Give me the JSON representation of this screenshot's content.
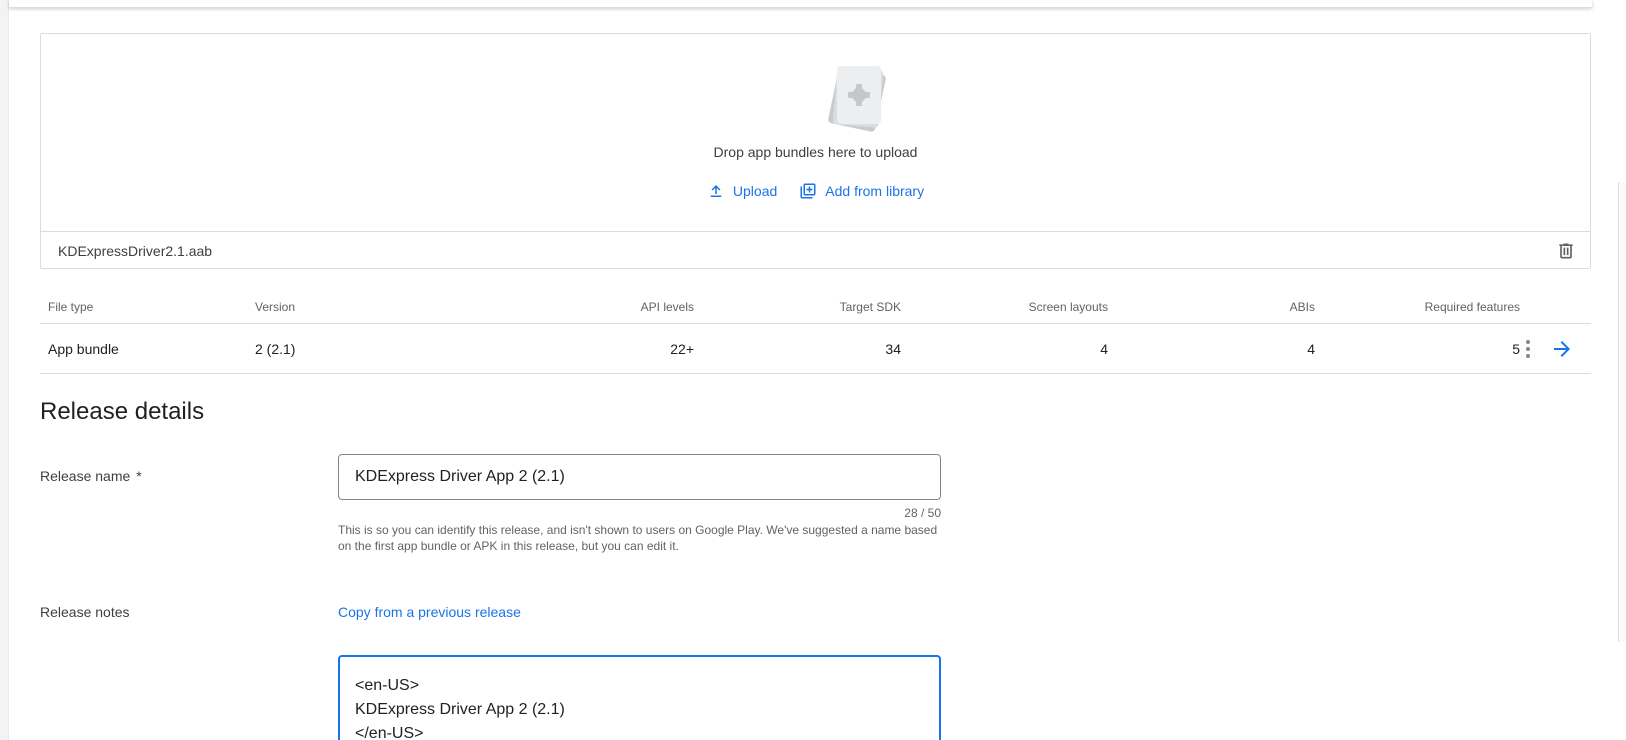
{
  "upload": {
    "drop_text": "Drop app bundles here to upload",
    "upload_label": "Upload",
    "library_label": "Add from library",
    "file_name": "KDExpressDriver2.1.aab"
  },
  "table": {
    "headers": {
      "file_type": "File type",
      "version": "Version",
      "api_levels": "API levels",
      "target_sdk": "Target SDK",
      "screen_layouts": "Screen layouts",
      "abis": "ABIs",
      "required_features": "Required features"
    },
    "row": {
      "file_type": "App bundle",
      "version": "2 (2.1)",
      "api_levels": "22+",
      "target_sdk": "34",
      "screen_layouts": "4",
      "abis": "4",
      "required_features": "5"
    }
  },
  "release": {
    "title": "Release details",
    "name_label": "Release name",
    "required_mark": "*",
    "name_value": "KDExpress Driver App 2 (2.1)",
    "char_count": "28 / 50",
    "hint": "This is so you can identify this release, and isn't shown to users on Google Play. We've suggested a name based on the first app bundle or APK in this release, but you can edit it.",
    "notes_label": "Release notes",
    "copy_link": "Copy from a previous release",
    "notes_value": "<en-US>\nKDExpress Driver App 2 (2.1)\n</en-US>"
  },
  "colors": {
    "accent": "#1a73e8",
    "border": "#dadce0",
    "text_primary": "#202124",
    "text_secondary": "#5f6368"
  }
}
